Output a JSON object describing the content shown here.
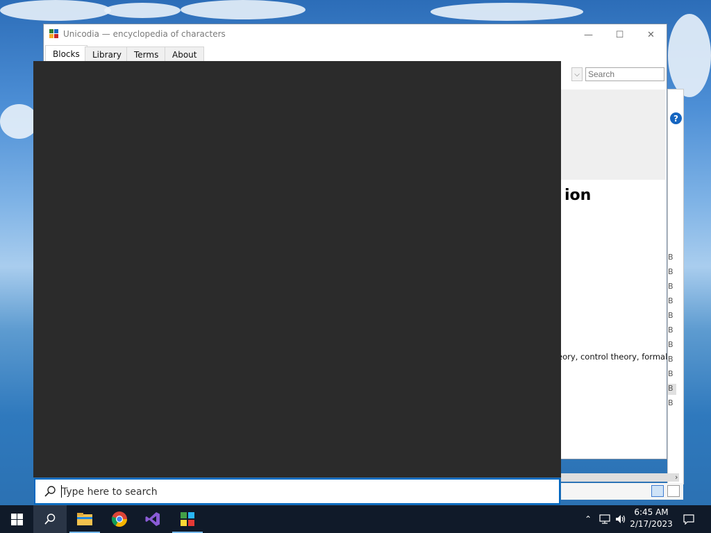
{
  "window": {
    "title": "Unicodia — encyclopedia of characters",
    "controls": {
      "minimize": "—",
      "maximize": "☐",
      "close": "✕"
    }
  },
  "tabs": [
    {
      "label": "Blocks",
      "active": true
    },
    {
      "label": "Library",
      "active": false
    },
    {
      "label": "Terms",
      "active": false
    },
    {
      "label": "About",
      "active": false
    }
  ],
  "toolbar": {
    "search_placeholder": "Search"
  },
  "content": {
    "heading_fragment": "ion",
    "body_fragment": "eory, control theory, formal"
  },
  "side_window": {
    "help_label": "?",
    "list_items": [
      "B",
      "B",
      "B",
      "B",
      "B",
      "B",
      "B",
      "B",
      "B",
      "B",
      "B"
    ]
  },
  "start_search": {
    "placeholder": "Type here to search"
  },
  "taskbar": {
    "apps": [
      "start-button",
      "search-button",
      "file-explorer",
      "chrome",
      "visual-studio",
      "unicodia"
    ],
    "time": "6:45 AM",
    "date": "2/17/2023"
  }
}
